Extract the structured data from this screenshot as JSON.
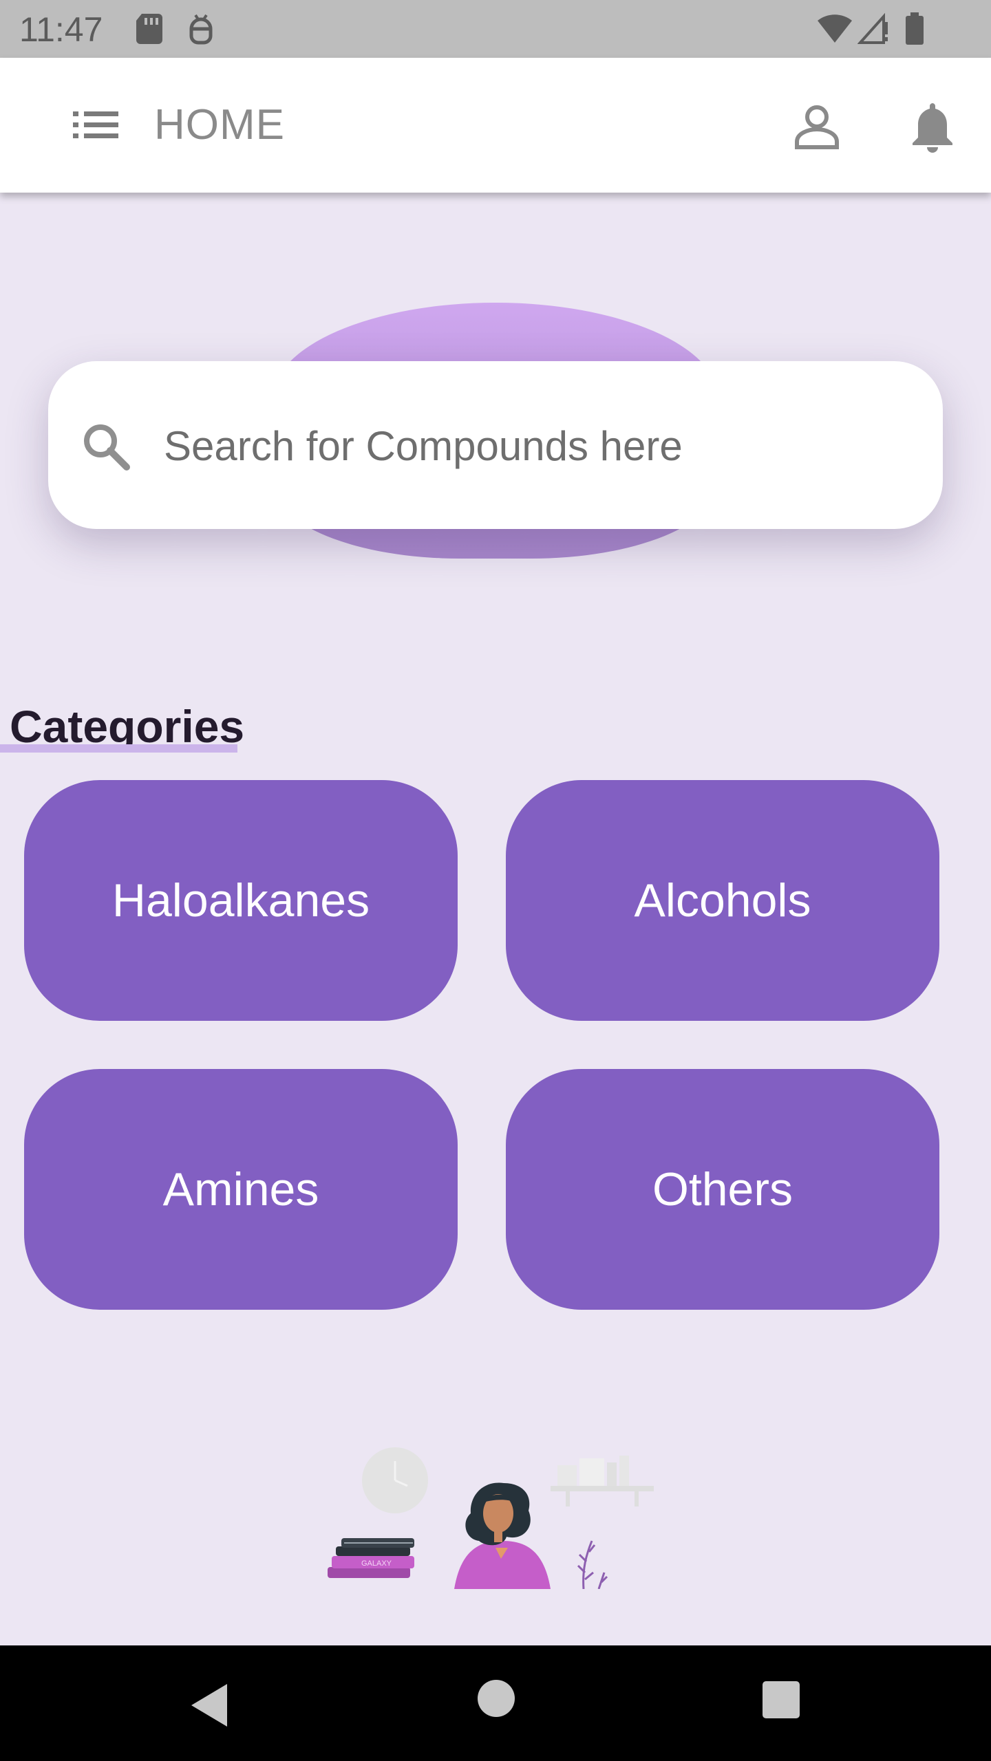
{
  "status_bar": {
    "time": "11:47",
    "icons": [
      "sd-card-icon",
      "android-debug-icon",
      "wifi-icon",
      "cell-signal-icon",
      "battery-icon"
    ]
  },
  "app_bar": {
    "title": "HOME",
    "icons": [
      "menu-list-icon",
      "person-icon",
      "bell-icon"
    ]
  },
  "search": {
    "placeholder": "Search for Compounds here",
    "value": ""
  },
  "categories": {
    "heading": "Categories",
    "items": [
      {
        "label": "Haloalkanes"
      },
      {
        "label": "Alcohols"
      },
      {
        "label": "Amines"
      },
      {
        "label": "Others"
      }
    ]
  },
  "illustration": {
    "book_spine_text": "GALAXY"
  },
  "nav_bar": {
    "icons": [
      "back-icon",
      "home-icon",
      "recents-icon"
    ]
  },
  "colors": {
    "accent": "#825fc2",
    "background": "#ece6f3",
    "status_bar": "#bdbdbd",
    "heading": "#241b2e"
  }
}
